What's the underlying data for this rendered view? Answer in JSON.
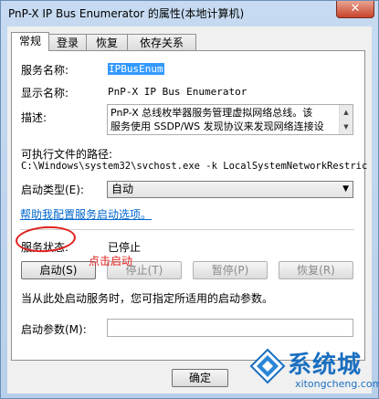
{
  "window": {
    "title": "PnP-X IP Bus Enumerator 的属性(本地计算机)",
    "close_label": "✕"
  },
  "tabs": [
    {
      "label": "常规",
      "active": true
    },
    {
      "label": "登录",
      "active": false
    },
    {
      "label": "恢复",
      "active": false
    },
    {
      "label": "依存关系",
      "active": false
    }
  ],
  "general": {
    "service_name_label": "服务名称:",
    "service_name_value": "IPBusEnum",
    "display_name_label": "显示名称:",
    "display_name_value": "PnP-X IP Bus Enumerator",
    "description_label": "描述:",
    "description_line1": "PnP-X 总线枚举器服务管理虚拟网络总线。该",
    "description_line2": "服务使用 SSDP/WS 发现协议来发现网络连接设",
    "exec_path_label": "可执行文件的路径:",
    "exec_path_value": "C:\\Windows\\system32\\svchost.exe -k LocalSystemNetworkRestric",
    "startup_type_label": "启动类型(E):",
    "startup_type_value": "自动",
    "help_link": "帮助我配置服务启动选项。",
    "status_label": "服务状态:",
    "status_value": "已停止",
    "start_button": "启动(S)",
    "stop_button": "停止(T)",
    "pause_button": "暂停(P)",
    "resume_button": "恢复(R)",
    "hint_text": "当从此处启动服务时，您可指定所适用的启动参数。",
    "params_label": "启动参数(M):",
    "params_value": ""
  },
  "annotation": {
    "text": "点击启动",
    "color": "#e0201d"
  },
  "footer": {
    "ok_button": "确定"
  },
  "watermark": {
    "brand": "系统城",
    "url": "xitongcheng.com"
  },
  "colors": {
    "selection": "#3399ff",
    "link": "#0066cc",
    "close": "#c7432a"
  }
}
